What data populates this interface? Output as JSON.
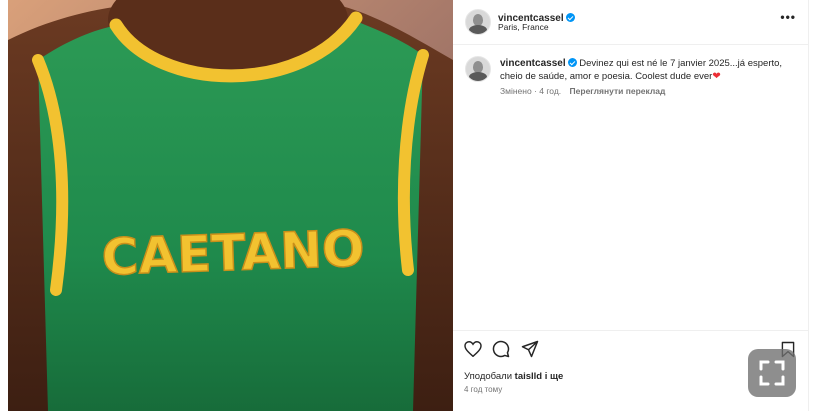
{
  "post": {
    "author": "vincentcassel",
    "location": "Paris, France",
    "caption_author": "vincentcassel",
    "caption_text": "Devinez qui est né le 7 janvier 2025...já esperto, cheio de saúde, amor e poesia. Coolest dude ever",
    "caption_emoji": "❤",
    "edited_label": "Змінено",
    "time_short": "4 год.",
    "translate_label": "Переглянути переклад",
    "likes_prefix": "Уподобали",
    "likes_user": "taislld",
    "likes_suffix": "і ще",
    "time_ago": "4 год тому",
    "image_text": "CAETANO"
  },
  "icons": {
    "verified": "verified-badge-icon",
    "more": "more-options-icon",
    "like": "heart-outline-icon",
    "comment": "comment-bubble-icon",
    "share": "paper-plane-icon",
    "save": "bookmark-icon",
    "fullscreen": "fullscreen-corners-icon"
  },
  "colors": {
    "verified_blue": "#0095f6",
    "heart_red": "#ed2f36",
    "jersey_green": "#1f8a4c",
    "jersey_yellow": "#f2c230"
  }
}
